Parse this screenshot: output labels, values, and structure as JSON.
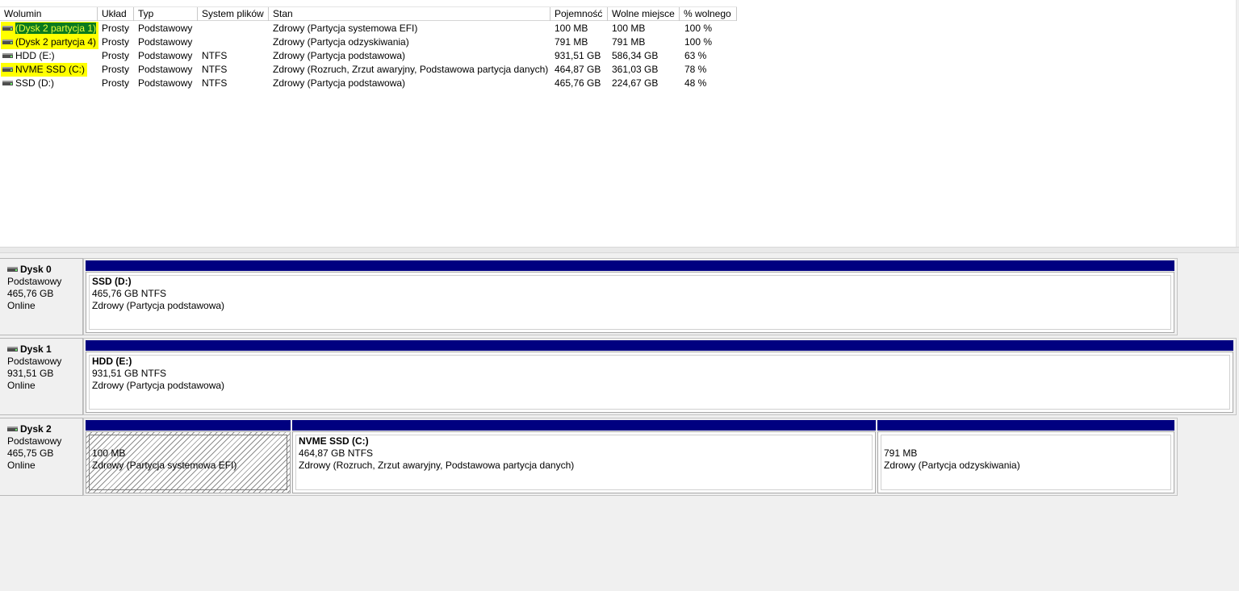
{
  "columns": [
    "Wolumin",
    "Układ",
    "Typ",
    "System plików",
    "Stan",
    "Pojemność",
    "Wolne miejsce",
    "% wolnego"
  ],
  "volumes": [
    {
      "name": "(Dysk 2 partycja 1)",
      "layout": "Prosty",
      "type": "Podstawowy",
      "fs": "",
      "status": "Zdrowy (Partycja systemowa EFI)",
      "capacity": "100 MB",
      "free": "100 MB",
      "pct": "100 %",
      "highlight": "selected"
    },
    {
      "name": "(Dysk 2 partycja 4)",
      "layout": "Prosty",
      "type": "Podstawowy",
      "fs": "",
      "status": "Zdrowy (Partycja odzyskiwania)",
      "capacity": "791 MB",
      "free": "791 MB",
      "pct": "100 %",
      "highlight": "yellow"
    },
    {
      "name": "HDD (E:)",
      "layout": "Prosty",
      "type": "Podstawowy",
      "fs": "NTFS",
      "status": "Zdrowy (Partycja podstawowa)",
      "capacity": "931,51 GB",
      "free": "586,34 GB",
      "pct": "63 %",
      "highlight": "none"
    },
    {
      "name": "NVME SSD (C:)",
      "layout": "Prosty",
      "type": "Podstawowy",
      "fs": "NTFS",
      "status": "Zdrowy (Rozruch, Zrzut awaryjny, Podstawowa partycja danych)",
      "capacity": "464,87 GB",
      "free": "361,03 GB",
      "pct": "78 %",
      "highlight": "yellow"
    },
    {
      "name": "SSD (D:)",
      "layout": "Prosty",
      "type": "Podstawowy",
      "fs": "NTFS",
      "status": "Zdrowy (Partycja podstawowa)",
      "capacity": "465,76 GB",
      "free": "224,67 GB",
      "pct": "48 %",
      "highlight": "none"
    }
  ],
  "disks": [
    {
      "title": "Dysk 0",
      "type": "Podstawowy",
      "size": "465,76 GB",
      "state": "Online",
      "partitions": [
        {
          "name": "SSD  (D:)",
          "detail": "465,76 GB NTFS",
          "status": "Zdrowy (Partycja podstawowa)",
          "hatched": false
        }
      ]
    },
    {
      "title": "Dysk 1",
      "type": "Podstawowy",
      "size": "931,51 GB",
      "state": "Online",
      "partitions": [
        {
          "name": "HDD  (E:)",
          "detail": "931,51 GB NTFS",
          "status": "Zdrowy (Partycja podstawowa)",
          "hatched": false
        }
      ]
    },
    {
      "title": "Dysk 2",
      "type": "Podstawowy",
      "size": "465,75 GB",
      "state": "Online",
      "partitions": [
        {
          "name": "",
          "detail": "100 MB",
          "status": "Zdrowy (Partycja systemowa EFI)",
          "hatched": true
        },
        {
          "name": "NVME SSD  (C:)",
          "detail": "464,87 GB NTFS",
          "status": "Zdrowy (Rozruch, Zrzut awaryjny, Podstawowa partycja danych)",
          "hatched": false
        },
        {
          "name": "",
          "detail": "791 MB",
          "status": "Zdrowy (Partycja odzyskiwania)",
          "hatched": false
        }
      ]
    }
  ],
  "colors": {
    "partition_bar": "#000080",
    "highlight": "#ffff00",
    "selection": "#0a7a1e"
  },
  "icons": {
    "disk": "disk-drive-icon"
  }
}
